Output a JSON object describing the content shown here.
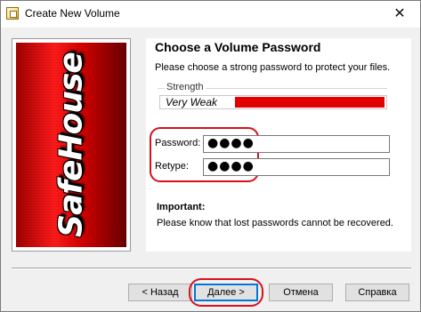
{
  "window": {
    "title": "Create New Volume",
    "close_glyph": "✕"
  },
  "banner": {
    "logo_text": "SafeHouse"
  },
  "content": {
    "heading": "Choose a Volume Password",
    "subtext": "Please choose a strong password to protect your files.",
    "strength": {
      "label": "Strength",
      "value_text": "Very Weak",
      "level_percent": 100,
      "bar_color": "#e30000"
    },
    "password": {
      "label": "Password:",
      "value": "●●●●"
    },
    "retype": {
      "label": "Retype:",
      "value": "●●●●"
    },
    "important_title": "Important:",
    "important_text": "Please know that lost passwords cannot be recovered."
  },
  "buttons": {
    "back": "< Назад",
    "next": "Далее >",
    "cancel": "Отмена",
    "help": "Справка"
  },
  "colors": {
    "annotation_red": "#d8101a",
    "default_button_blue": "#0078d7"
  }
}
